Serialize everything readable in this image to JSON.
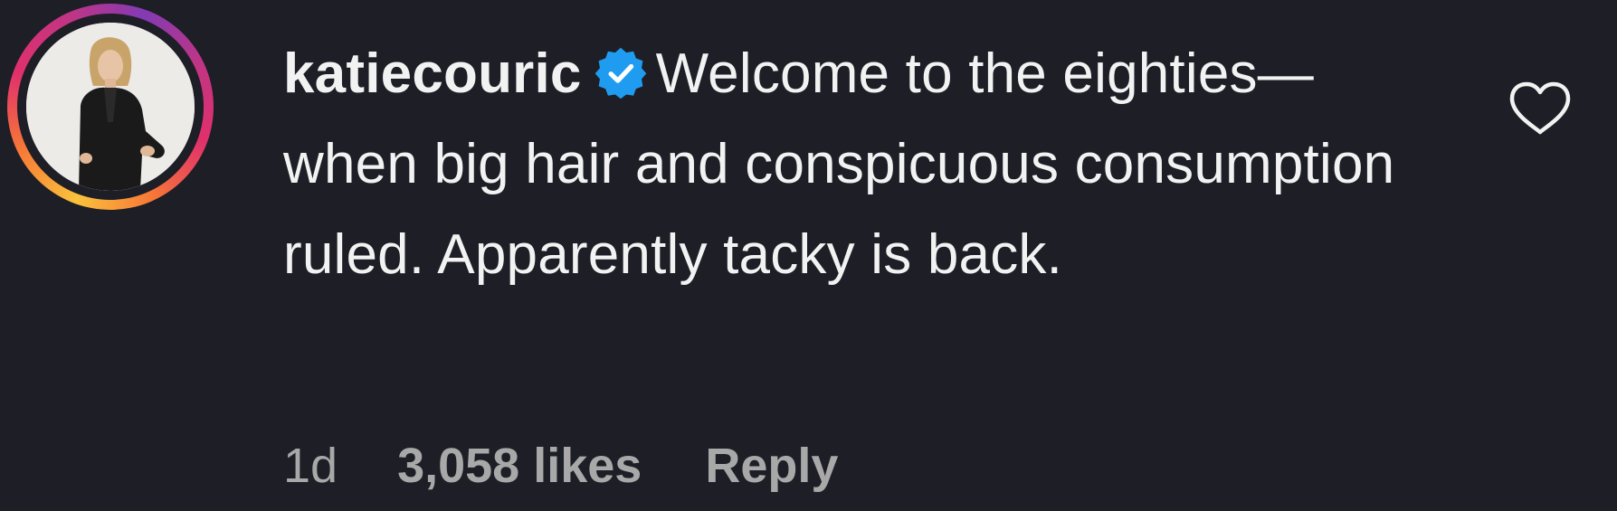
{
  "comment": {
    "username": "katiecouric",
    "verified": true,
    "text": "Welcome to the eighties—when big hair and conspicuous consumption ruled. Apparently tacky is back.",
    "timestamp": "1d",
    "likes": "3,058 likes",
    "reply_label": "Reply"
  },
  "icons": {
    "avatar": "profile-photo",
    "verified": "verified-badge-icon",
    "like": "heart-outline-icon"
  },
  "colors": {
    "background": "#1d1e26",
    "text": "#f2f2f2",
    "muted": "#a8a8a8",
    "verified_blue": "#1f9cf0",
    "story_ring_start": "#f9c23c",
    "story_ring_end": "#c13584"
  }
}
